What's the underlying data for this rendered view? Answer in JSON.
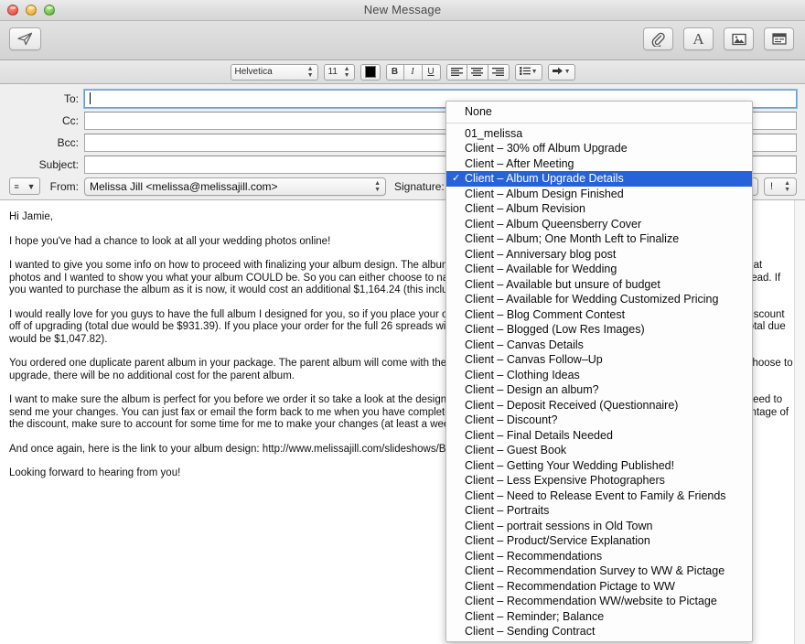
{
  "window": {
    "title": "New Message",
    "traffic_lights": [
      "close",
      "minimize",
      "zoom"
    ]
  },
  "toolbar": {
    "send_label": "Send",
    "attach_label": "Attach",
    "fonts_label": "A",
    "photo_label": "Photo Browser",
    "stationery_label": "Stationery"
  },
  "formatbar": {
    "font_family": "Helvetica",
    "font_size": "11",
    "color_swatch": "#000000",
    "bold": "B",
    "italic": "I",
    "underline": "U",
    "align_left": "align-left",
    "align_center": "align-center",
    "align_right": "align-right",
    "list_label": "",
    "indent_label": ""
  },
  "fields": {
    "to_label": "To:",
    "to_value": "",
    "cc_label": "Cc:",
    "cc_value": "",
    "bcc_label": "Bcc:",
    "bcc_value": "",
    "subject_label": "Subject:",
    "subject_value": "",
    "from_label": "From:",
    "from_value": "Melissa Jill <melissa@melissajill.com>",
    "signature_label": "Signature:",
    "signature_value": "Client – Album Upgrade Details",
    "priority_label": "!",
    "header_fields_label": "≡"
  },
  "body": {
    "paragraphs": [
      "Hi Jamie,",
      "I hope you've had a chance to look at all your wedding photos online!",
      "I wanted to give you some info on how to proceed with finalizing your album design. The album you ordered included 16 spreads, but you guys had so many great photos and I wanted to show you what your album COULD be. So you can either choose to narrow it down to 16 spreads, or add additional spreads at $120/spread. If you wanted to purchase the album as it is now, it would cost an additional $1,164.24 (this includes tax).",
      "I would really love for you guys to have the full album I designed for you, so if you place your order for the full 26 spreads within 1 month, I will give you a 20% discount off of upgrading (total due would be $931.39). If you place your order for the full 26 spreads within 2 months (by February 2nd), I will give you a 10% discount (total due would be $1,047.82).",
      "You ordered one duplicate parent album in your package. The parent album will come with the same number of spreads as your album, so no matter what you choose to upgrade, there will be no additional cost for the parent album.",
      "I want to make sure the album is perfect for you before we order it so take a look at the design and let me know what changes you would like to make. You will need to send me your changes. You can just fax or email the form back to me when you have completed it (all contact info is on the form). Also, if you want to take advantage of the discount, make sure to account for some time for me to make your changes (at least a week per round of revisions) before we place your order.",
      "And once again, here is the link to your album design:  http://www.melissajill.com/slideshows/BoggsAlbum",
      "Looking forward to hearing from you!"
    ]
  },
  "signature_menu": {
    "none_label": "None",
    "selected_index": 3,
    "items": [
      "01_melissa",
      "Client – 30% off Album Upgrade",
      "Client – After Meeting",
      "Client – Album Upgrade Details",
      "Client – Album Design Finished",
      "Client – Album Revision",
      "Client – Album Queensberry Cover",
      "Client – Album; One Month Left to Finalize",
      "Client – Anniversary blog post",
      "Client – Available for Wedding",
      "Client – Available but unsure of budget",
      "Client – Available for Wedding Customized Pricing",
      "Client – Blog Comment Contest",
      "Client – Blogged (Low Res Images)",
      "Client – Canvas Details",
      "Client – Canvas Follow–Up",
      "Client – Clothing Ideas",
      "Client – Design an album?",
      "Client – Deposit Received (Questionnaire)",
      "Client – Discount?",
      "Client – Final Details Needed",
      "Client – Guest Book",
      "Client – Getting Your Wedding Published!",
      "Client – Less Expensive Photographers",
      "Client – Need to Release Event to Family & Friends",
      "Client – Portraits",
      "Client – portrait sessions in Old Town",
      "Client – Product/Service Explanation",
      "Client – Recommendations",
      "Client – Recommendation Survey to WW & Pictage",
      "Client – Recommendation Pictage to WW",
      "Client – Recommendation WW/website to Pictage",
      "Client – Reminder; Balance",
      "Client – Sending Contract"
    ],
    "checkmark": "✓",
    "highlight_color": "#2662d9"
  }
}
